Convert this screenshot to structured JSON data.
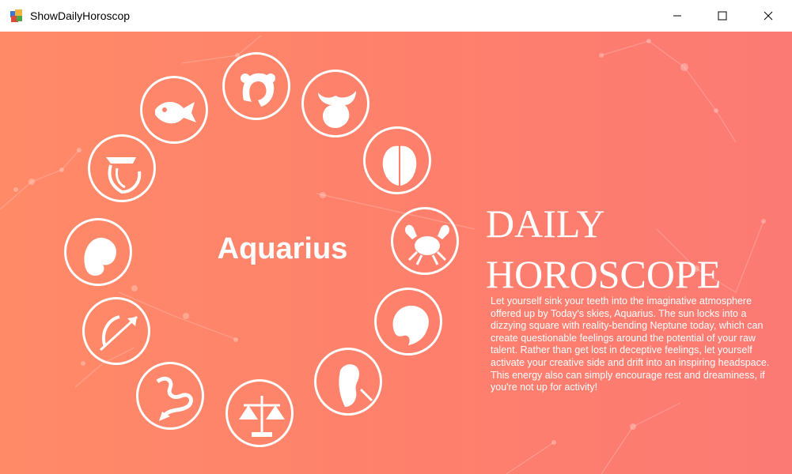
{
  "window": {
    "title": "ShowDailyHoroscop",
    "controls": [
      "minimize-icon",
      "maximize-icon",
      "close-icon"
    ]
  },
  "horoscope": {
    "sign_name": "Aquarius",
    "heading_line1": "DAILY",
    "heading_line2": "HOROSCOPE",
    "text": "Let yourself sink your teeth into the imaginative atmosphere offered up by Today's skies, Aquarius. The sun locks into a dizzying square with reality-bending Neptune today, which can create questionable feelings around the potential of your raw talent. Rather than get lost in deceptive feelings, let yourself activate your creative side and drift into an inspiring headspace. This energy also can simply encourage rest and dreaminess, if you're not up for activity!"
  },
  "zodiac_wheel": [
    "aries",
    "taurus",
    "gemini",
    "cancer",
    "leo",
    "virgo",
    "libra",
    "scorpio",
    "sagittarius",
    "capricorn",
    "aquarius",
    "pisces"
  ],
  "colors": {
    "background_left": "#ff8a68",
    "background_right": "#fb7a74",
    "foreground": "#ffffff"
  }
}
